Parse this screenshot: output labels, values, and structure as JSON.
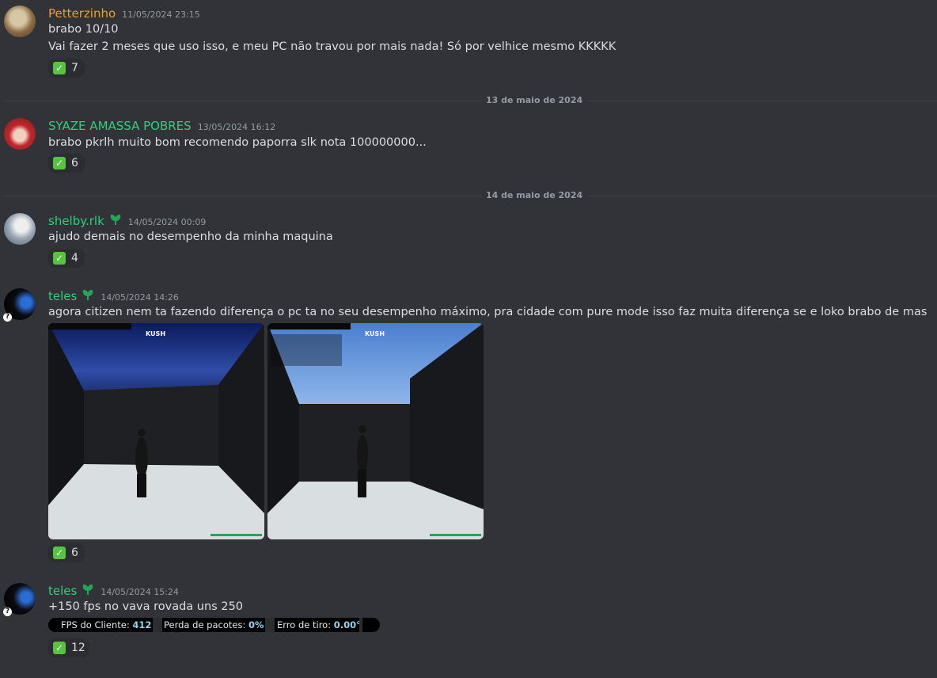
{
  "messages": [
    {
      "author": "Petterzinho",
      "author_color": "#e9a02c",
      "timestamp": "11/05/2024 23:15",
      "lines": [
        "brabo 10/10",
        "Vai fazer 2 meses que uso isso, e meu PC não travou por mais nada! Só por velhice mesmo KKKKK"
      ],
      "reaction": {
        "emoji": "white-check-mark",
        "count": "7"
      }
    },
    {
      "author": "SYAZE AMASSA POBRES",
      "author_color": "#2fd07a",
      "timestamp": "13/05/2024 16:12",
      "lines": [
        "brabo pkrlh muito bom recomendo paporra slk nota 100000000..."
      ],
      "reaction": {
        "emoji": "white-check-mark",
        "count": "6"
      }
    },
    {
      "author": "shelby.rlk",
      "author_color": "#2fd07a",
      "timestamp": "14/05/2024 00:09",
      "lines": [
        "ajudo demais no desempenho da minha maquina"
      ],
      "reaction": {
        "emoji": "white-check-mark",
        "count": "4"
      }
    },
    {
      "author": "teles",
      "author_color": "#2fd07a",
      "timestamp": "14/05/2024 14:26",
      "lines": [
        "agora citizen nem ta fazendo diferença o pc ta no seu desempenho máximo, pra cidade com pure mode isso faz muita diferença se e loko brabo de mas"
      ],
      "attachments": [
        {
          "logo": "KUSH"
        },
        {
          "logo": "KUSH"
        }
      ],
      "reaction": {
        "emoji": "white-check-mark",
        "count": "6"
      }
    },
    {
      "author": "teles",
      "author_color": "#2fd07a",
      "timestamp": "14/05/2024 15:24",
      "lines": [
        "+150 fps no vava rovada uns 250"
      ],
      "stats": {
        "fps_label": "FPS do Cliente:",
        "fps_value": "412",
        "loss_label": "Perda de pacotes:",
        "loss_value": "0%",
        "error_label": "Erro de tiro:",
        "error_value": "0.00°"
      },
      "reaction": {
        "emoji": "white-check-mark",
        "count": "12"
      }
    }
  ],
  "dividers": [
    "13 de maio de 2024",
    "14 de maio de 2024"
  ],
  "colors": {
    "background": "#313338",
    "text": "#dbdee1",
    "muted": "#949ba4",
    "reaction_bg": "#2b2d31"
  }
}
